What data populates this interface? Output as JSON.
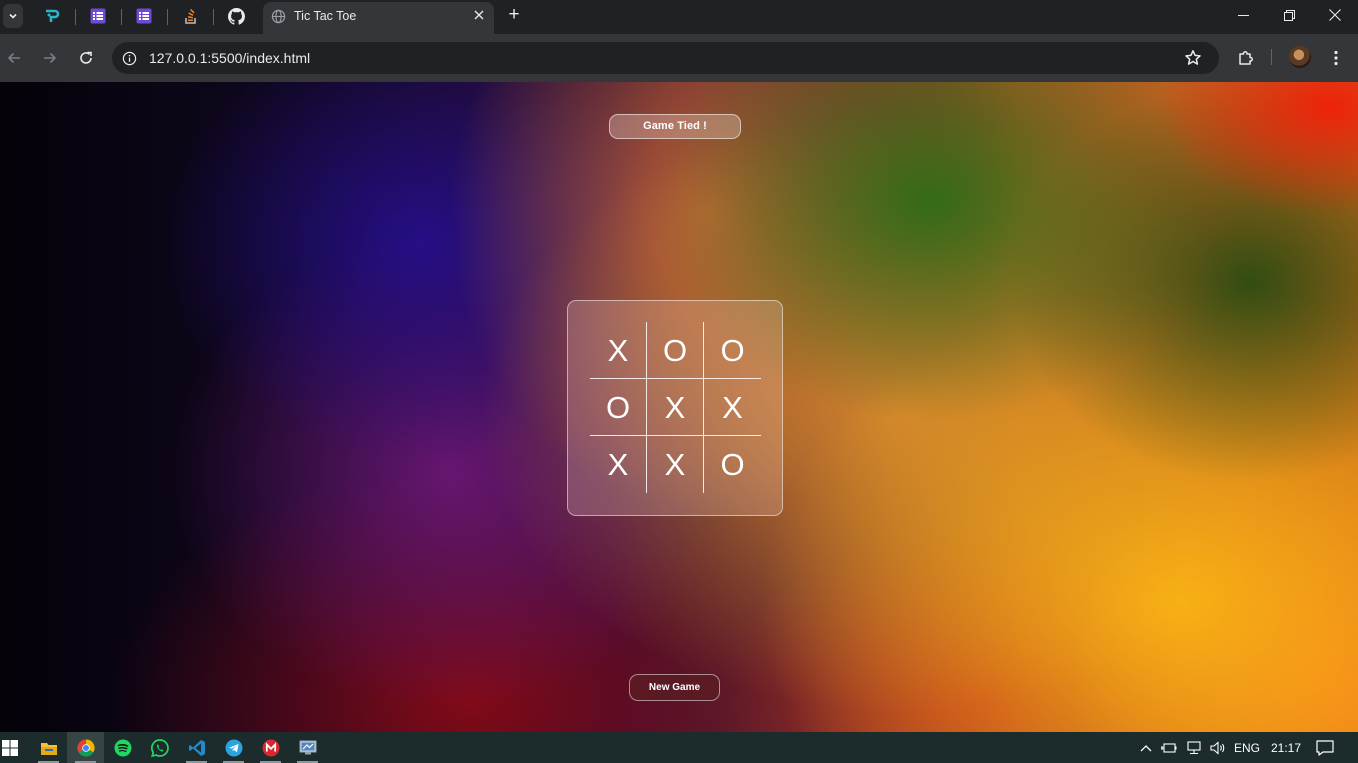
{
  "browser": {
    "tab_title": "Tic Tac Toe",
    "url": "127.0.0.1:5500/index.html",
    "new_tab_label": "+"
  },
  "page": {
    "status_message": "Game Tied !",
    "new_game_label": "New Game",
    "board": {
      "cells": [
        "X",
        "O",
        "O",
        "O",
        "X",
        "X",
        "X",
        "X",
        "O"
      ]
    }
  },
  "taskbar": {
    "apps": [
      "start-icon",
      "file-explorer-icon",
      "chrome-icon",
      "spotify-icon",
      "whatsapp-icon",
      "vscode-icon",
      "telegram-icon",
      "mega-icon",
      "remote-desktop-icon"
    ],
    "language": "ENG",
    "time": "21:17"
  },
  "colors": {
    "browser_bg": "#202124",
    "toolbar_bg": "#35363a",
    "taskbar_bg": "#1c2b2b",
    "text_light": "#e8eaed"
  }
}
